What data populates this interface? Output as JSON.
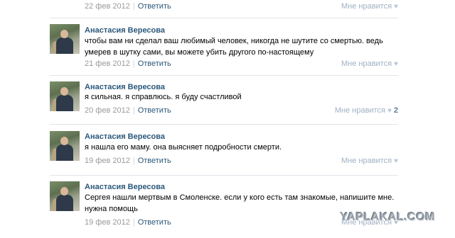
{
  "like_label": "Мне нравится",
  "reply_label": "Ответить",
  "author": "Анастасия Вересова",
  "comments": [
    {
      "date": "22 фев 2012",
      "likes": ""
    },
    {
      "text": "чтобы вам ни сделал ваш любимый человек, никогда не шутите со смертью. ведь умерев в шутку сами, вы можете убить другого по-настоящему",
      "date": "21 фев 2012",
      "likes": ""
    },
    {
      "text": "я сильная. я справлюсь. я буду счастливой",
      "date": "20 фев 2012",
      "likes": "2"
    },
    {
      "text": "я нашла его маму. она выясняет подробности смерти.",
      "date": "19 фев 2012",
      "likes": ""
    },
    {
      "text": "Сергея нашли мертвым в Смоленске. если у кого есть там знакомые, напишите мне. нужна помощь",
      "date": "19 фев 2012",
      "likes": ""
    }
  ],
  "watermark": "YAPLAKAL.COM",
  "colors": {
    "link": "#2b587a",
    "muted": "#999999",
    "like": "#9fb1c4",
    "divider": "#dfe4ea"
  }
}
